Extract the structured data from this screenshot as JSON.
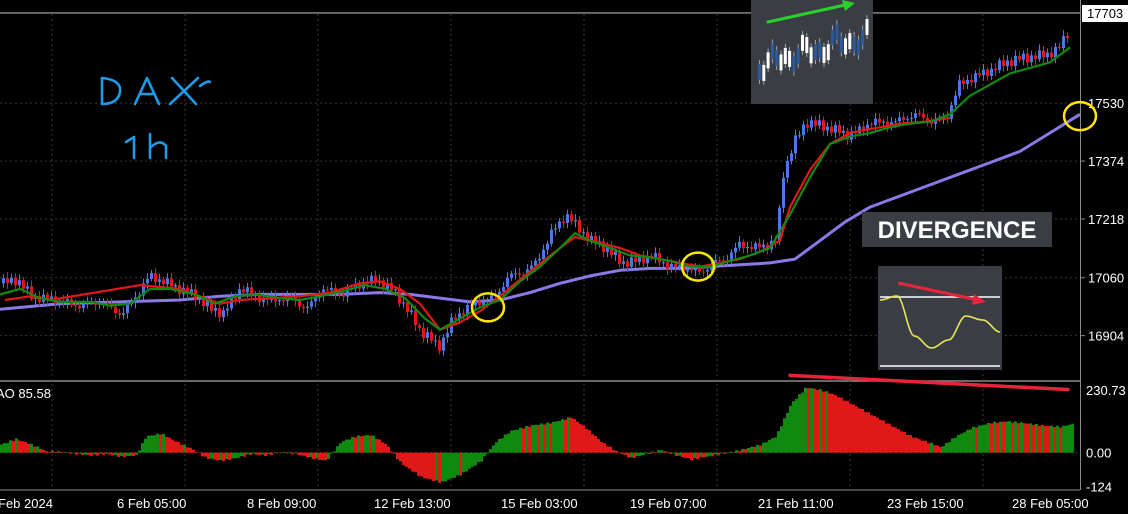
{
  "annotations": {
    "divergence_label": "DIVERGENCE",
    "colors": {
      "highlight_circle": "#ffe600",
      "trend_arrow": "#2bd12b",
      "divergence_line": "#e8243c",
      "handwriting": "#1e9be6"
    }
  },
  "chart_data": [
    {
      "type": "candlestick",
      "title": "",
      "instrument_note": "DAX 1h",
      "price_labels": [
        "17703"
      ],
      "y_ticks": [
        16904,
        17060,
        17218,
        17374,
        17530
      ],
      "ylim": [
        16790,
        17770
      ],
      "x_ticks": [
        "Feb 2024",
        "6 Feb 05:00",
        "8 Feb 09:00",
        "12 Feb 13:00",
        "15 Feb 03:00",
        "19 Feb 07:00",
        "21 Feb 11:00",
        "23 Feb 15:00",
        "28 Feb 05:00"
      ],
      "grid": true,
      "colors": {
        "up": "#4a78e8",
        "down": "#e01818",
        "fast_ma": "#0f8a0f",
        "signal_ma": "#e01818",
        "slow_ma": "#8a7ae8"
      },
      "close_path": [
        [
          0,
          17045
        ],
        [
          16,
          17055
        ],
        [
          30,
          17010
        ],
        [
          55,
          17000
        ],
        [
          75,
          16985
        ],
        [
          100,
          16995
        ],
        [
          120,
          16960
        ],
        [
          135,
          17010
        ],
        [
          148,
          17065
        ],
        [
          162,
          17050
        ],
        [
          178,
          17030
        ],
        [
          195,
          17010
        ],
        [
          210,
          16975
        ],
        [
          222,
          16965
        ],
        [
          240,
          17035
        ],
        [
          252,
          17010
        ],
        [
          268,
          17000
        ],
        [
          290,
          17005
        ],
        [
          305,
          16975
        ],
        [
          322,
          17030
        ],
        [
          340,
          17015
        ],
        [
          360,
          17045
        ],
        [
          375,
          17055
        ],
        [
          392,
          17025
        ],
        [
          405,
          16980
        ],
        [
          418,
          16920
        ],
        [
          428,
          16900
        ],
        [
          437,
          16870
        ],
        [
          450,
          16940
        ],
        [
          465,
          16980
        ],
        [
          480,
          16995
        ],
        [
          495,
          17010
        ],
        [
          507,
          17065
        ],
        [
          520,
          17070
        ],
        [
          535,
          17100
        ],
        [
          550,
          17180
        ],
        [
          565,
          17230
        ],
        [
          578,
          17190
        ],
        [
          590,
          17160
        ],
        [
          605,
          17140
        ],
        [
          620,
          17100
        ],
        [
          635,
          17105
        ],
        [
          650,
          17120
        ],
        [
          668,
          17090
        ],
        [
          685,
          17085
        ],
        [
          700,
          17075
        ],
        [
          712,
          17100
        ],
        [
          725,
          17110
        ],
        [
          738,
          17150
        ],
        [
          752,
          17140
        ],
        [
          768,
          17150
        ],
        [
          775,
          17160
        ],
        [
          782,
          17340
        ],
        [
          792,
          17420
        ],
        [
          805,
          17480
        ],
        [
          818,
          17470
        ],
        [
          832,
          17460
        ],
        [
          845,
          17445
        ],
        [
          858,
          17455
        ],
        [
          870,
          17480
        ],
        [
          885,
          17475
        ],
        [
          900,
          17485
        ],
        [
          915,
          17500
        ],
        [
          930,
          17480
        ],
        [
          945,
          17490
        ],
        [
          958,
          17580
        ],
        [
          972,
          17600
        ],
        [
          990,
          17620
        ],
        [
          1005,
          17640
        ],
        [
          1018,
          17650
        ],
        [
          1030,
          17655
        ],
        [
          1045,
          17660
        ],
        [
          1058,
          17680
        ],
        [
          1065,
          17715
        ]
      ],
      "fast_ma_path": [
        [
          0,
          17015
        ],
        [
          20,
          17030
        ],
        [
          40,
          17005
        ],
        [
          60,
          16995
        ],
        [
          90,
          16995
        ],
        [
          110,
          16985
        ],
        [
          130,
          16990
        ],
        [
          150,
          17030
        ],
        [
          170,
          17030
        ],
        [
          195,
          17015
        ],
        [
          215,
          16990
        ],
        [
          235,
          17010
        ],
        [
          255,
          17015
        ],
        [
          280,
          17005
        ],
        [
          300,
          17000
        ],
        [
          320,
          17010
        ],
        [
          345,
          17025
        ],
        [
          365,
          17040
        ],
        [
          385,
          17030
        ],
        [
          405,
          17005
        ],
        [
          425,
          16950
        ],
        [
          440,
          16920
        ],
        [
          460,
          16950
        ],
        [
          480,
          16980
        ],
        [
          500,
          17000
        ],
        [
          520,
          17050
        ],
        [
          540,
          17090
        ],
        [
          560,
          17140
        ],
        [
          575,
          17180
        ],
        [
          590,
          17160
        ],
        [
          610,
          17140
        ],
        [
          630,
          17120
        ],
        [
          650,
          17115
        ],
        [
          670,
          17105
        ],
        [
          690,
          17090
        ],
        [
          710,
          17090
        ],
        [
          730,
          17105
        ],
        [
          750,
          17120
        ],
        [
          770,
          17140
        ],
        [
          790,
          17230
        ],
        [
          810,
          17330
        ],
        [
          830,
          17420
        ],
        [
          850,
          17440
        ],
        [
          870,
          17450
        ],
        [
          890,
          17465
        ],
        [
          910,
          17475
        ],
        [
          930,
          17480
        ],
        [
          950,
          17500
        ],
        [
          970,
          17550
        ],
        [
          990,
          17580
        ],
        [
          1010,
          17610
        ],
        [
          1030,
          17625
        ],
        [
          1050,
          17640
        ],
        [
          1070,
          17680
        ]
      ],
      "signal_ma_path": [
        [
          5,
          17000
        ],
        [
          30,
          17010
        ],
        [
          50,
          17000
        ],
        [
          140,
          17040
        ],
        [
          160,
          17035
        ],
        [
          180,
          17030
        ],
        [
          200,
          17010
        ],
        [
          220,
          16990
        ],
        [
          240,
          17000
        ],
        [
          300,
          17010
        ],
        [
          330,
          17020
        ],
        [
          360,
          17045
        ],
        [
          380,
          17050
        ],
        [
          400,
          17030
        ],
        [
          420,
          16990
        ],
        [
          440,
          16920
        ],
        [
          460,
          16940
        ],
        [
          480,
          16970
        ],
        [
          500,
          17010
        ],
        [
          520,
          17055
        ],
        [
          560,
          17140
        ],
        [
          575,
          17170
        ],
        [
          590,
          17160
        ],
        [
          605,
          17150
        ],
        [
          620,
          17140
        ],
        [
          640,
          17120
        ],
        [
          660,
          17110
        ],
        [
          680,
          17100
        ],
        [
          700,
          17090
        ],
        [
          720,
          17100
        ],
        [
          740,
          17110
        ],
        [
          760,
          17130
        ],
        [
          780,
          17160
        ],
        [
          790,
          17250
        ],
        [
          810,
          17350
        ],
        [
          830,
          17420
        ],
        [
          850,
          17450
        ],
        [
          870,
          17460
        ],
        [
          900,
          17475
        ],
        [
          925,
          17480
        ],
        [
          950,
          17490
        ]
      ],
      "slow_ma_path": [
        [
          0,
          16975
        ],
        [
          60,
          16990
        ],
        [
          120,
          16995
        ],
        [
          180,
          17000
        ],
        [
          220,
          17010
        ],
        [
          260,
          17015
        ],
        [
          300,
          17015
        ],
        [
          340,
          17015
        ],
        [
          380,
          17020
        ],
        [
          410,
          17015
        ],
        [
          440,
          17005
        ],
        [
          470,
          16995
        ],
        [
          500,
          17000
        ],
        [
          530,
          17020
        ],
        [
          560,
          17045
        ],
        [
          590,
          17065
        ],
        [
          620,
          17080
        ],
        [
          650,
          17085
        ],
        [
          680,
          17085
        ],
        [
          710,
          17090
        ],
        [
          740,
          17095
        ],
        [
          770,
          17100
        ],
        [
          795,
          17110
        ],
        [
          820,
          17160
        ],
        [
          845,
          17210
        ],
        [
          870,
          17250
        ],
        [
          900,
          17280
        ],
        [
          930,
          17310
        ],
        [
          960,
          17340
        ],
        [
          990,
          17370
        ],
        [
          1020,
          17400
        ],
        [
          1050,
          17450
        ],
        [
          1080,
          17500
        ]
      ],
      "circle_markers": [
        {
          "x": 488,
          "y": 16980
        },
        {
          "x": 698,
          "y": 17090
        },
        {
          "x": 1080,
          "y": 17495
        }
      ],
      "trend_arrow": {
        "from": [
          768,
          17740
        ],
        "to": [
          853,
          17770
        ]
      }
    },
    {
      "type": "bar",
      "title": "",
      "series_label": "AO 85.58",
      "value_label": "85.58",
      "y_ticks": [
        230.73,
        0.0,
        -124
      ],
      "ylim": [
        -130,
        245
      ],
      "colors": {
        "up": "#0f8a0f",
        "down": "#e01818"
      },
      "profile": [
        [
          0,
          30
        ],
        [
          15,
          50
        ],
        [
          30,
          30
        ],
        [
          45,
          5
        ],
        [
          60,
          3
        ],
        [
          75,
          -5
        ],
        [
          90,
          -10
        ],
        [
          105,
          -5
        ],
        [
          120,
          -15
        ],
        [
          135,
          -10
        ],
        [
          145,
          60
        ],
        [
          160,
          70
        ],
        [
          175,
          40
        ],
        [
          190,
          15
        ],
        [
          205,
          -20
        ],
        [
          220,
          -30
        ],
        [
          235,
          -20
        ],
        [
          250,
          -5
        ],
        [
          265,
          -10
        ],
        [
          280,
          2
        ],
        [
          295,
          -5
        ],
        [
          310,
          -20
        ],
        [
          325,
          -30
        ],
        [
          340,
          40
        ],
        [
          355,
          60
        ],
        [
          370,
          65
        ],
        [
          385,
          30
        ],
        [
          400,
          -40
        ],
        [
          420,
          -90
        ],
        [
          440,
          -110
        ],
        [
          460,
          -80
        ],
        [
          480,
          -30
        ],
        [
          495,
          40
        ],
        [
          510,
          80
        ],
        [
          530,
          100
        ],
        [
          550,
          110
        ],
        [
          570,
          130
        ],
        [
          585,
          90
        ],
        [
          600,
          40
        ],
        [
          615,
          5
        ],
        [
          630,
          -20
        ],
        [
          645,
          -5
        ],
        [
          660,
          10
        ],
        [
          675,
          -10
        ],
        [
          690,
          -25
        ],
        [
          705,
          -15
        ],
        [
          720,
          -5
        ],
        [
          740,
          10
        ],
        [
          760,
          30
        ],
        [
          775,
          60
        ],
        [
          790,
          180
        ],
        [
          805,
          240
        ],
        [
          820,
          230
        ],
        [
          835,
          210
        ],
        [
          850,
          180
        ],
        [
          865,
          150
        ],
        [
          880,
          120
        ],
        [
          895,
          90
        ],
        [
          910,
          60
        ],
        [
          925,
          40
        ],
        [
          940,
          20
        ],
        [
          955,
          60
        ],
        [
          970,
          90
        ],
        [
          990,
          110
        ],
        [
          1005,
          115
        ],
        [
          1020,
          110
        ],
        [
          1040,
          100
        ],
        [
          1060,
          95
        ],
        [
          1070,
          105
        ]
      ],
      "divergence_line": {
        "from": [
          790,
          240
        ],
        "to": [
          1068,
          140
        ]
      }
    },
    {
      "type": "line",
      "title": "",
      "inset": "price trend (top-right)",
      "series": [
        {
          "values": [
            0.3,
            0.6,
            0.45,
            0.75,
            0.55,
            0.9,
            0.7,
            0.95
          ]
        }
      ]
    },
    {
      "type": "line",
      "title": "",
      "inset": "oscillator divergence",
      "series": [
        {
          "values": [
            0.85,
            0.9,
            0.4,
            0.25,
            0.35,
            0.65,
            0.6,
            0.45
          ]
        }
      ]
    }
  ]
}
